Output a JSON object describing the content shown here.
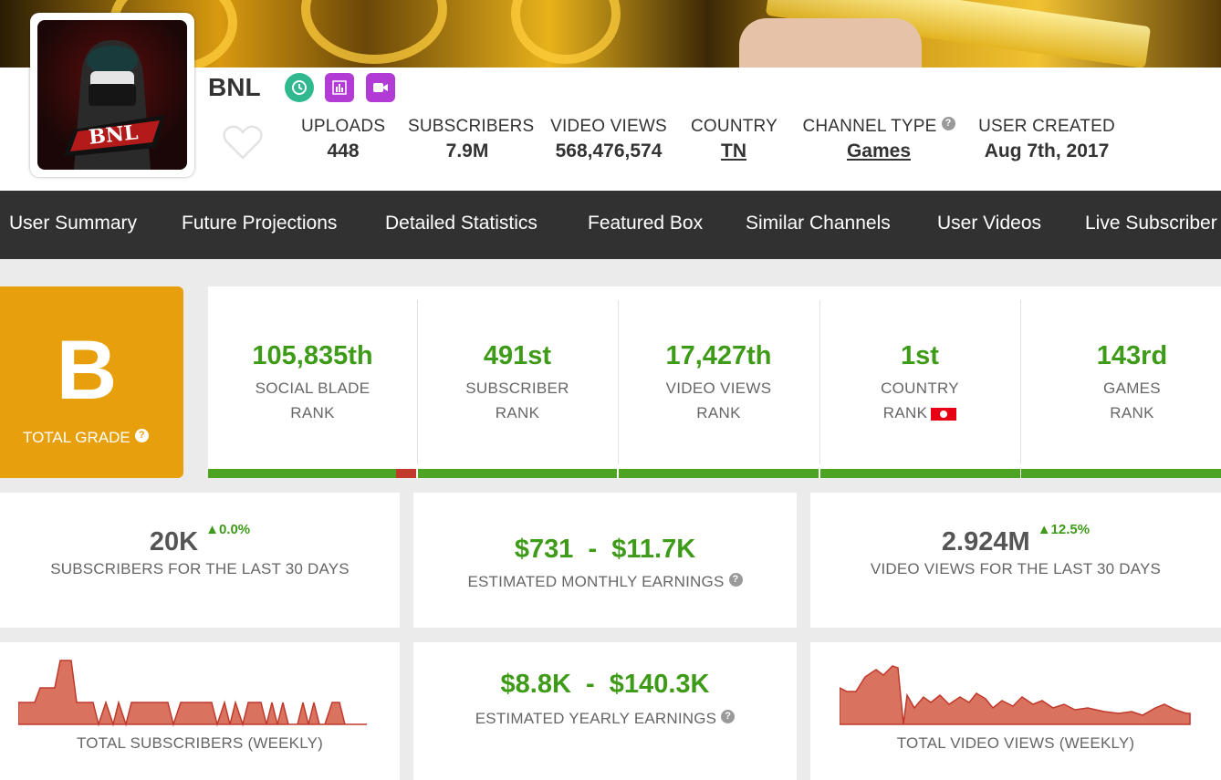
{
  "channel": {
    "name": "BNL",
    "avatar_text": "BNL",
    "badges": [
      "clock-icon",
      "bar-chart-icon",
      "video-camera-icon"
    ]
  },
  "stats": {
    "uploads_label": "UPLOADS",
    "uploads": "448",
    "subscribers_label": "SUBSCRIBERS",
    "subscribers": "7.9M",
    "views_label": "VIDEO VIEWS",
    "views": "568,476,574",
    "country_label": "COUNTRY",
    "country": "TN",
    "type_label": "CHANNEL TYPE",
    "type": "Games",
    "created_label": "USER CREATED",
    "created": "Aug 7th, 2017",
    "help": "?"
  },
  "nav": [
    "User Summary",
    "Future Projections",
    "Detailed Statistics",
    "Featured Box",
    "Similar Channels",
    "User Videos",
    "Live Subscriber"
  ],
  "grade": {
    "letter": "B",
    "label": "TOTAL GRADE"
  },
  "ranks": [
    {
      "value": "105,835th",
      "line1": "SOCIAL BLADE",
      "line2": "RANK"
    },
    {
      "value": "491st",
      "line1": "SUBSCRIBER",
      "line2": "RANK"
    },
    {
      "value": "17,427th",
      "line1": "VIDEO VIEWS",
      "line2": "RANK"
    },
    {
      "value": "1st",
      "line1": "COUNTRY",
      "line2": "RANK"
    },
    {
      "value": "143rd",
      "line1": "GAMES",
      "line2": "RANK"
    }
  ],
  "summary": {
    "subs30": "20K",
    "subs30_delta": "0.0%",
    "subs30_label": "SUBSCRIBERS FOR THE LAST 30 DAYS",
    "monthly": "$731  -  $11.7K",
    "monthly_label": "ESTIMATED MONTHLY EARNINGS",
    "views30": "2.924M",
    "views30_delta": "12.5%",
    "views30_label": "VIDEO VIEWS FOR THE LAST 30 DAYS",
    "yearly": "$8.8K  -  $140.3K",
    "yearly_label": "ESTIMATED YEARLY EARNINGS",
    "subs_chart_label": "TOTAL SUBSCRIBERS (WEEKLY)",
    "views_chart_label": "TOTAL VIDEO VIEWS (WEEKLY)"
  },
  "colors": {
    "accent_green": "#3e9b18",
    "grade_orange": "#e7a00b",
    "nav_bg": "#313131",
    "spark_fill": "#d9725f"
  }
}
